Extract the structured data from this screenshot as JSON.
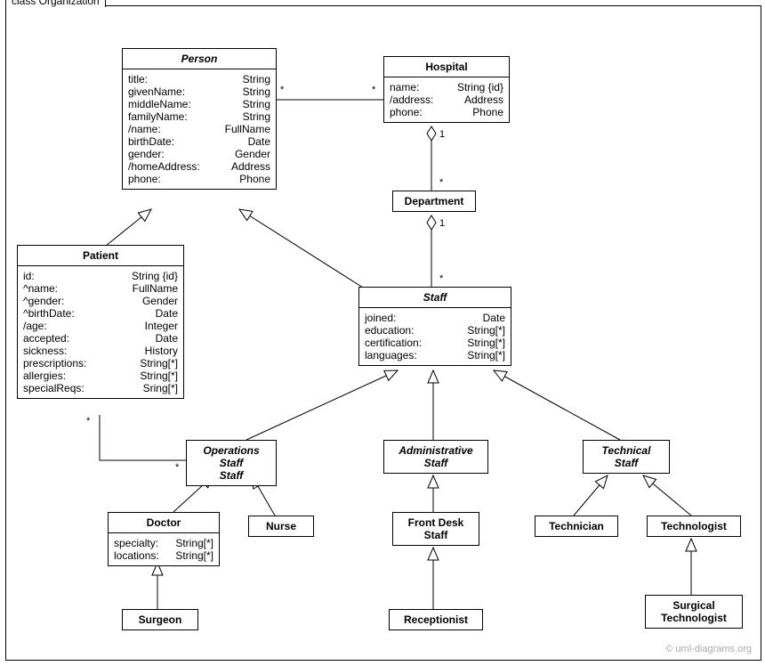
{
  "package": {
    "name": "class Organization"
  },
  "watermark": "© uml-diagrams.org",
  "classes": {
    "person": {
      "name": "Person",
      "abstract": true,
      "attrs": [
        {
          "n": "title:",
          "t": "String"
        },
        {
          "n": "givenName:",
          "t": "String"
        },
        {
          "n": "middleName:",
          "t": "String"
        },
        {
          "n": "familyName:",
          "t": "String"
        },
        {
          "n": "/name:",
          "t": "FullName"
        },
        {
          "n": "birthDate:",
          "t": "Date"
        },
        {
          "n": "gender:",
          "t": "Gender"
        },
        {
          "n": "/homeAddress:",
          "t": "Address"
        },
        {
          "n": "phone:",
          "t": "Phone"
        }
      ]
    },
    "hospital": {
      "name": "Hospital",
      "abstract": false,
      "attrs": [
        {
          "n": "name:",
          "t": "String {id}"
        },
        {
          "n": "/address:",
          "t": "Address"
        },
        {
          "n": "phone:",
          "t": "Phone"
        }
      ]
    },
    "department": {
      "name": "Department",
      "abstract": false,
      "attrs": []
    },
    "patient": {
      "name": "Patient",
      "abstract": false,
      "attrs": [
        {
          "n": "id:",
          "t": "String {id}"
        },
        {
          "n": "^name:",
          "t": "FullName"
        },
        {
          "n": "^gender:",
          "t": "Gender"
        },
        {
          "n": "^birthDate:",
          "t": "Date"
        },
        {
          "n": "/age:",
          "t": "Integer"
        },
        {
          "n": "accepted:",
          "t": "Date"
        },
        {
          "n": "sickness:",
          "t": "History"
        },
        {
          "n": "prescriptions:",
          "t": "String[*]"
        },
        {
          "n": "allergies:",
          "t": "String[*]"
        },
        {
          "n": "specialReqs:",
          "t": "Sring[*]"
        }
      ]
    },
    "staff": {
      "name": "Staff",
      "abstract": true,
      "attrs": [
        {
          "n": "joined:",
          "t": "Date"
        },
        {
          "n": "education:",
          "t": "String[*]"
        },
        {
          "n": "certification:",
          "t": "String[*]"
        },
        {
          "n": "languages:",
          "t": "String[*]"
        }
      ]
    },
    "opsStaff": {
      "name": "Operations Staff",
      "line2": "Staff",
      "abstract": true,
      "attrs": []
    },
    "adminStaff": {
      "name": "Administrative",
      "line2": "Staff",
      "abstract": true,
      "attrs": []
    },
    "techStaff": {
      "name": "Technical",
      "line2": "Staff",
      "abstract": true,
      "attrs": []
    },
    "doctor": {
      "name": "Doctor",
      "abstract": false,
      "attrs": [
        {
          "n": "specialty:",
          "t": "String[*]"
        },
        {
          "n": "locations:",
          "t": "String[*]"
        }
      ]
    },
    "nurse": {
      "name": "Nurse",
      "abstract": false,
      "attrs": []
    },
    "frontDesk": {
      "name": "Front Desk",
      "line2": "Staff",
      "abstract": false,
      "attrs": []
    },
    "technician": {
      "name": "Technician",
      "abstract": false,
      "attrs": []
    },
    "technologist": {
      "name": "Technologist",
      "abstract": false,
      "attrs": []
    },
    "surgeon": {
      "name": "Surgeon",
      "abstract": false,
      "attrs": []
    },
    "receptionist": {
      "name": "Receptionist",
      "abstract": false,
      "attrs": []
    },
    "surgicalTech": {
      "name": "Surgical",
      "line2": "Technologist",
      "abstract": false,
      "attrs": []
    }
  },
  "mult": {
    "personHospL": "*",
    "personHospR": "*",
    "hospDeptTop": "1",
    "hospDeptBot": "*",
    "deptStaffTop": "1",
    "deptStaffBot": "*",
    "patientOpsTop": "*",
    "patientOpsBot": "*"
  }
}
